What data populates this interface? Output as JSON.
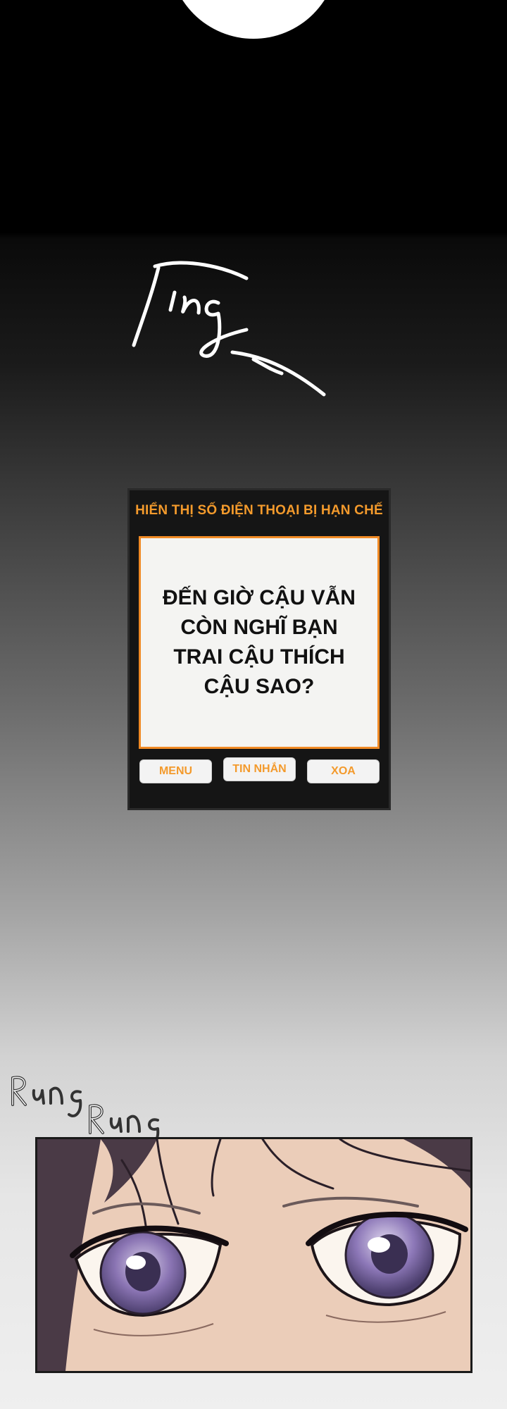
{
  "sfx": {
    "ting": "Ting_",
    "rung": [
      "Rung",
      "Rung"
    ]
  },
  "phone": {
    "header": "HIỂN THỊ SỐ ĐIỆN THOẠI BỊ HẠN CHẾ",
    "message": "ĐẾN GIỜ CẬU VẪN CÒN NGHĨ BẠN TRAI CẬU THÍCH CẬU SAO?",
    "buttons": {
      "menu": "MENU",
      "reply": "TIN NHẮN",
      "delete": "XOA"
    }
  },
  "colors": {
    "accent": "#f39a2c",
    "frame": "#151515",
    "message_bg": "#f4f4f2",
    "eye_iris": "#7f6ba5"
  },
  "panel": {
    "subject": "close-up-eyes-illustration"
  }
}
